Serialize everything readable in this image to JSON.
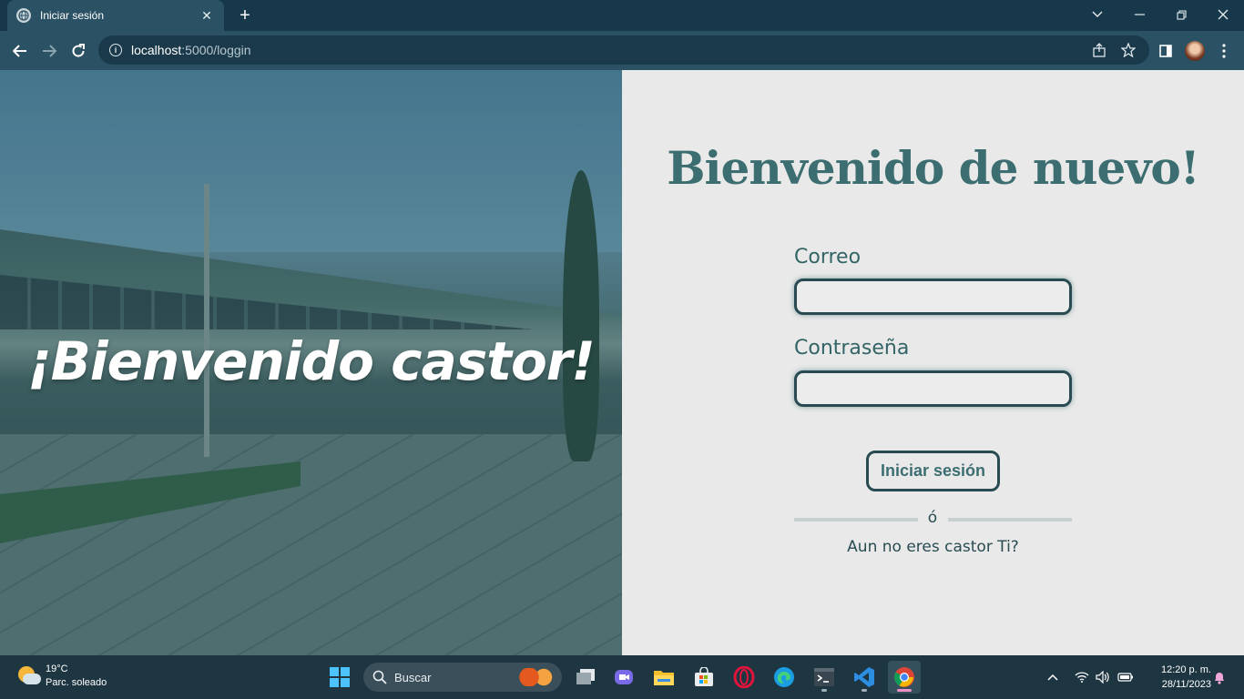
{
  "browser": {
    "tab_title": "Iniciar sesión",
    "tab_close": "✕",
    "new_tab": "+",
    "url_host": "localhost",
    "url_path": ":5000/loggin"
  },
  "hero": {
    "title": "¡Bienvenido castor!"
  },
  "login": {
    "title": "Bienvenido de nuevo!",
    "email_label": "Correo",
    "email_value": "",
    "password_label": "Contraseña",
    "password_value": "",
    "submit_label": "Iniciar sesión",
    "divider_text": "ó",
    "signup_text": "Aun no eres castor Ti?"
  },
  "taskbar": {
    "weather_temp": "19°C",
    "weather_desc": "Parc. soleado",
    "search_placeholder": "Buscar",
    "time": "12:20 p. m.",
    "date": "28/11/2023"
  },
  "colors": {
    "accent": "#3c6e71",
    "border": "#284b52",
    "panel_bg": "#e9e9e9",
    "chrome_bg": "#2a5164"
  }
}
